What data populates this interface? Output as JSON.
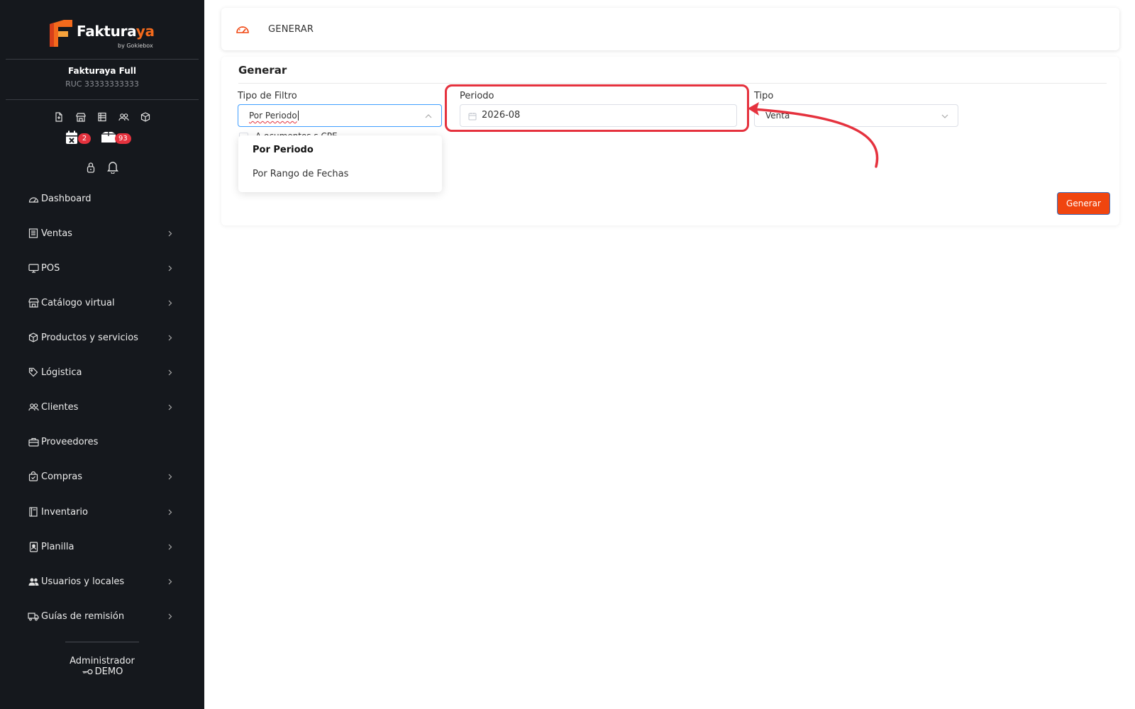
{
  "brand": {
    "name_main": "Faktura",
    "name_accent": "ya",
    "byline": "by Gokiebox"
  },
  "company": {
    "name": "Fakturaya Full",
    "ruc": "RUC 33333333333"
  },
  "quick_icons": [
    "new-document-icon",
    "store-icon",
    "table-icon",
    "users-icon",
    "box-icon"
  ],
  "badges": [
    {
      "icon": "calendar-x-icon",
      "count": "2"
    },
    {
      "icon": "boxes-icon",
      "count": "93"
    }
  ],
  "sidebar": {
    "items": [
      {
        "label": "Dashboard",
        "icon": "dashboard-icon",
        "has_arrow": false
      },
      {
        "label": "Ventas",
        "icon": "receipt-icon",
        "has_arrow": true
      },
      {
        "label": "POS",
        "icon": "monitor-icon",
        "has_arrow": true
      },
      {
        "label": "Catálogo virtual",
        "icon": "store-icon",
        "has_arrow": true
      },
      {
        "label": "Productos y servicios",
        "icon": "box-icon",
        "has_arrow": true
      },
      {
        "label": "Lógistica",
        "icon": "tag-icon",
        "has_arrow": true
      },
      {
        "label": "Clientes",
        "icon": "users-icon",
        "has_arrow": true
      },
      {
        "label": "Proveedores",
        "icon": "briefcase-icon",
        "has_arrow": false
      },
      {
        "label": "Compras",
        "icon": "shopping-bag-icon",
        "has_arrow": true
      },
      {
        "label": "Inventario",
        "icon": "notebook-icon",
        "has_arrow": true
      },
      {
        "label": "Planilla",
        "icon": "id-badge-icon",
        "has_arrow": true
      },
      {
        "label": "Usuarios y locales",
        "icon": "user-group-icon",
        "has_arrow": true
      },
      {
        "label": "Guías de remisión",
        "icon": "truck-icon",
        "has_arrow": true
      }
    ]
  },
  "footer": {
    "role": "Administrador",
    "user": "DEMO"
  },
  "header": {
    "title": "GENERAR"
  },
  "form": {
    "title": "Generar",
    "filter_type": {
      "label": "Tipo de Filtro",
      "value": "Por Periodo",
      "options": [
        "Por Periodo",
        "Por Rango de Fechas"
      ]
    },
    "period": {
      "label": "Periodo",
      "value": "2026-08"
    },
    "type": {
      "label": "Tipo",
      "value": "Venta"
    },
    "checkbox_partial_text": "A              ocumentos  s    CPE",
    "generate_button": "Generar"
  },
  "colors": {
    "sidebar_bg": "#15181d",
    "accent": "#f0450f",
    "badge": "#e5323e",
    "annotation": "#e5323e"
  }
}
